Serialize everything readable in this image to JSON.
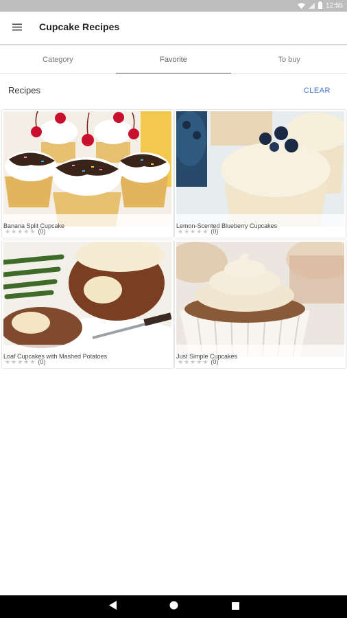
{
  "status_bar": {
    "time": "12:55"
  },
  "app_bar": {
    "title": "Cupcake Recipes"
  },
  "tabs": [
    {
      "label": "Category",
      "active": false
    },
    {
      "label": "Favorite",
      "active": true
    },
    {
      "label": "To buy",
      "active": false
    }
  ],
  "section": {
    "title": "Recipes",
    "clear_label": "CLEAR"
  },
  "recipes": [
    {
      "name": "Banana Split Cupcake",
      "rating_count": "(0)",
      "stars": 0
    },
    {
      "name": "Lemon-Scented Blueberry Cupcakes",
      "rating_count": "(0)",
      "stars": 0
    },
    {
      "name": "Loaf Cupcakes with Mashed Potatoes",
      "rating_count": "(0)",
      "stars": 0
    },
    {
      "name": "Just Simple Cupcakes",
      "rating_count": "(0)",
      "stars": 0
    }
  ],
  "colors": {
    "accent": "#3f6fc4",
    "status_bar": "#bdbdbd",
    "nav_bar": "#000000"
  }
}
